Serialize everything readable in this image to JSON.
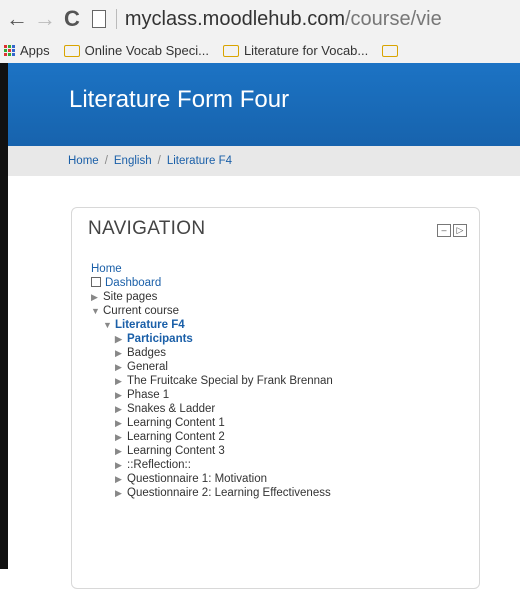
{
  "browser": {
    "url_domain": "myclass.moodlehub.com",
    "url_rest": "/course/vie"
  },
  "bookmarks": [
    {
      "label": "Apps"
    },
    {
      "label": "Online Vocab Speci..."
    },
    {
      "label": "Literature for Vocab..."
    }
  ],
  "page": {
    "title": "Literature Form Four"
  },
  "breadcrumb": {
    "items": [
      "Home",
      "English",
      "Literature F4"
    ],
    "separator": "/"
  },
  "navigation": {
    "title": "NAVIGATION",
    "home": "Home",
    "dashboard": "Dashboard",
    "site_pages": "Site pages",
    "current_course": "Current course",
    "course_name": "Literature F4",
    "participants": "Participants",
    "sections": [
      "Badges",
      "General",
      "The Fruitcake Special by Frank Brennan",
      "Phase 1",
      "Snakes & Ladder",
      "Learning Content 1",
      "Learning Content 2",
      "Learning Content 3",
      "::Reflection::",
      "Questionnaire 1: Motivation",
      "Questionnaire 2: Learning Effectiveness"
    ]
  }
}
